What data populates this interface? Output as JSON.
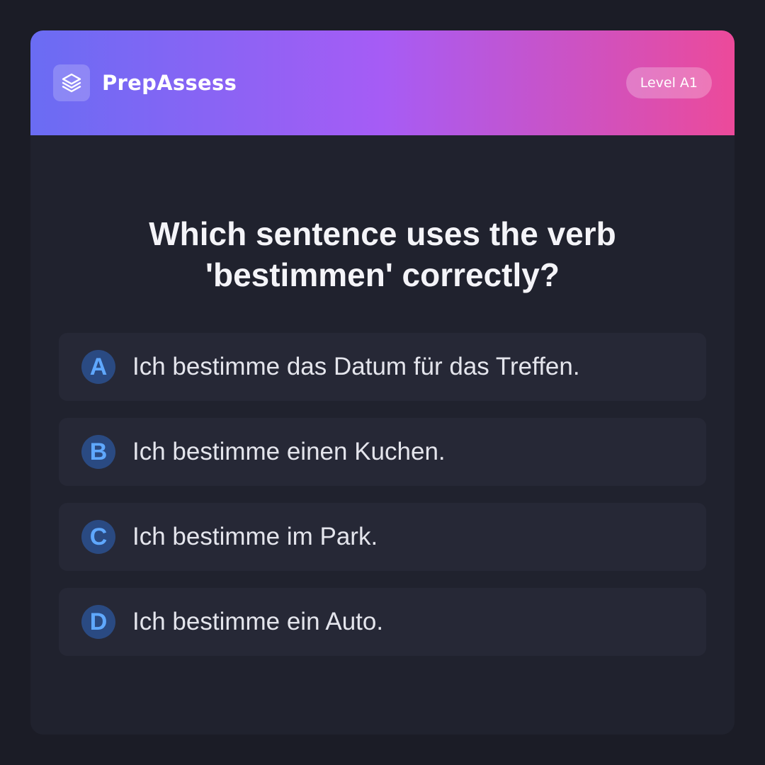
{
  "header": {
    "logo_icon": "layers-icon",
    "brand": "PrepAssess",
    "level": "Level A1"
  },
  "question": {
    "text": "Which sentence uses the verb 'bestimmen' correctly?"
  },
  "options": [
    {
      "letter": "A",
      "text": "Ich bestimme das Datum für das Treffen."
    },
    {
      "letter": "B",
      "text": "Ich bestimme einen Kuchen."
    },
    {
      "letter": "C",
      "text": "Ich bestimme im Park."
    },
    {
      "letter": "D",
      "text": "Ich bestimme ein Auto."
    }
  ],
  "colors": {
    "page_background": "#1b1c26",
    "card_background": "#20222e",
    "option_background": "#262836",
    "gradient_start": "#6a6cf3",
    "gradient_mid": "#a65cf5",
    "gradient_end": "#ec4a9a",
    "letter_circle": "#2a4a82",
    "letter_text": "#5fa8ff"
  }
}
